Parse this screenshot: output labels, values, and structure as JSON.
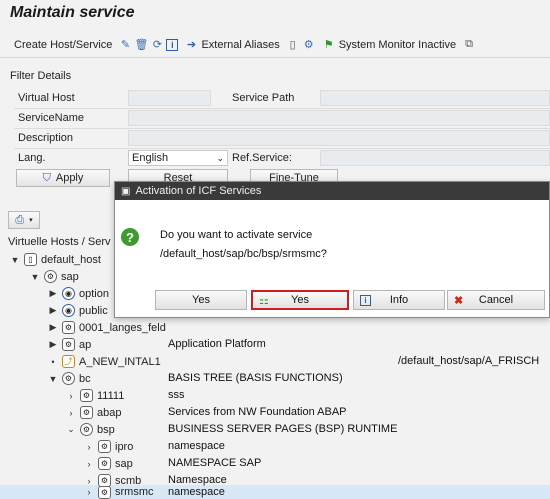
{
  "window": {
    "title": "Maintain service"
  },
  "toolbar": {
    "create_label": "Create Host/Service",
    "external_aliases": "External Aliases",
    "system_monitor": "System Monitor Inactive"
  },
  "filter": {
    "title": "Filter Details",
    "virtual_host_label": "Virtual Host",
    "service_path_label": "Service Path",
    "service_name_label": "ServiceName",
    "description_label": "Description",
    "lang_label": "Lang.",
    "lang_value": "English",
    "ref_service_label": "Ref.Service:",
    "apply_label": "Apply",
    "reset_label": "Reset",
    "fine_tune_label": "Fine-Tune"
  },
  "tree": {
    "header": "Virtuelle Hosts / Serv",
    "rows": [
      {
        "label": "default_host",
        "desc": ""
      },
      {
        "label": "sap",
        "desc": ""
      },
      {
        "label": "option",
        "desc": ""
      },
      {
        "label": "public",
        "desc": ""
      },
      {
        "label": "0001_langes_feld",
        "desc": ""
      },
      {
        "label": "ap",
        "desc": "Application Platform"
      },
      {
        "label": "A_NEW_INTAL1",
        "desc": "",
        "path": "/default_host/sap/A_FRISCH"
      },
      {
        "label": "bc",
        "desc": "BASIS TREE (BASIS FUNCTIONS)"
      },
      {
        "label": "11111",
        "desc": "sss"
      },
      {
        "label": "abap",
        "desc": "Services from NW Foundation ABAP"
      },
      {
        "label": "bsp",
        "desc": "BUSINESS SERVER PAGES (BSP) RUNTIME"
      },
      {
        "label": "ipro",
        "desc": "namespace"
      },
      {
        "label": "sap",
        "desc": "NAMESPACE SAP"
      },
      {
        "label": "scmb",
        "desc": "Namespace"
      },
      {
        "label": "srmsmc",
        "desc": "namespace"
      }
    ]
  },
  "dialog": {
    "title": "Activation of ICF Services",
    "question": "Do you want to activate service",
    "path": "/default_host/sap/bc/bsp/srmsmc?",
    "btn_yes1": "Yes",
    "btn_yes2": "Yes",
    "btn_info": "Info",
    "btn_cancel": "Cancel"
  }
}
